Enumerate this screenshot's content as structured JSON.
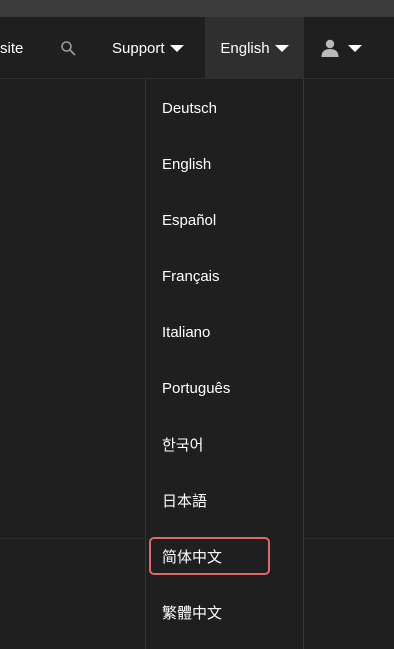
{
  "navbar": {
    "site_label": "site",
    "search_icon": "search-icon",
    "support_label": "Support",
    "language_label": "English",
    "user_icon": "user-icon",
    "caret_icon": "caret-down-icon"
  },
  "language_menu": {
    "items": [
      {
        "label": "Deutsch"
      },
      {
        "label": "English"
      },
      {
        "label": "Español"
      },
      {
        "label": "Français"
      },
      {
        "label": "Italiano"
      },
      {
        "label": "Português"
      },
      {
        "label": "한국어"
      },
      {
        "label": "日本語"
      },
      {
        "label": "简体中文"
      },
      {
        "label": "繁體中文"
      }
    ],
    "highlighted_index": 8
  },
  "colors": {
    "background": "#1e1e1e",
    "navbar_active": "#2f2f2f",
    "highlight_border": "#e06868"
  }
}
